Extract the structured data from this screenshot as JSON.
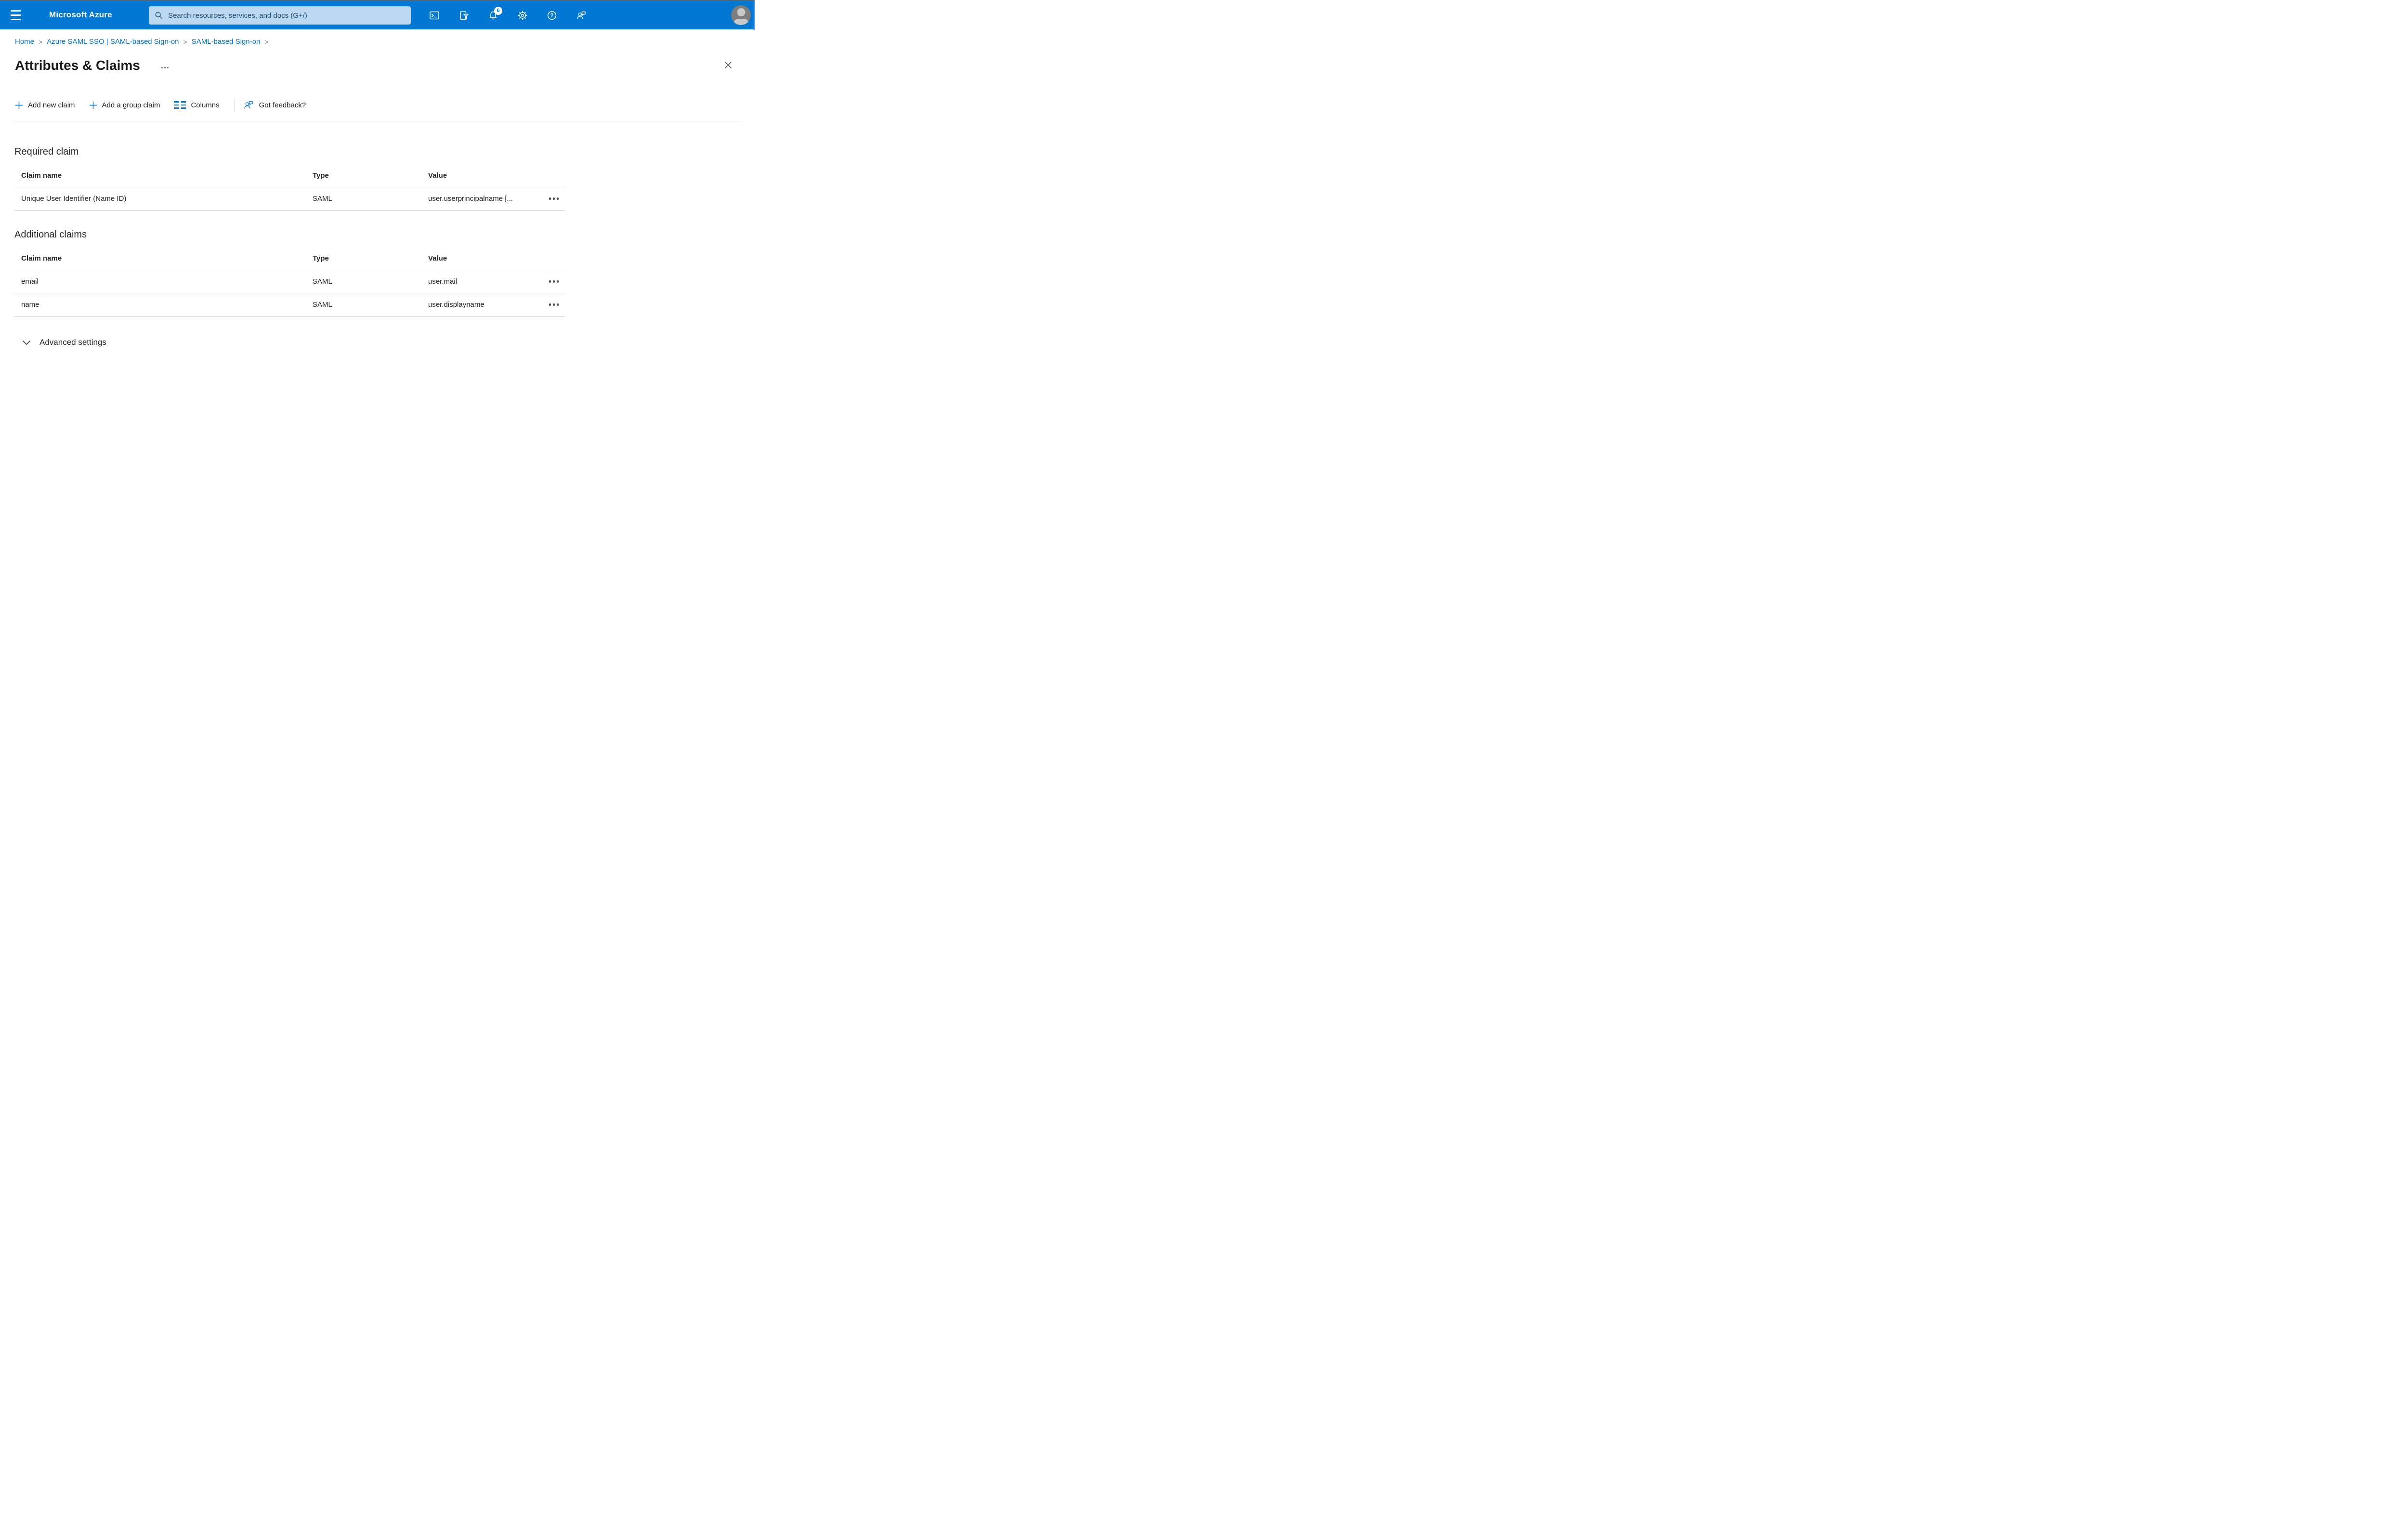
{
  "topbar": {
    "brand": "Microsoft Azure",
    "search_placeholder": "Search resources, services, and docs (G+/)",
    "notification_count": "6",
    "icons": [
      "cloud-shell-icon",
      "directory-filter-icon",
      "bell-icon",
      "gear-icon",
      "help-icon",
      "feedback-icon",
      "avatar"
    ]
  },
  "breadcrumb": {
    "separator": ">",
    "items": [
      {
        "label": "Home"
      },
      {
        "label": "Azure SAML SSO | SAML-based Sign-on"
      },
      {
        "label": "SAML-based Sign-on"
      }
    ]
  },
  "page": {
    "title": "Attributes & Claims"
  },
  "toolbar": {
    "items": [
      {
        "label": "Add new claim",
        "icon": "plus-icon"
      },
      {
        "label": "Add a group claim",
        "icon": "plus-icon"
      },
      {
        "label": "Columns",
        "icon": "columns-icon"
      },
      {
        "label": "Got feedback?",
        "icon": "feedback-person-icon"
      }
    ]
  },
  "sections": {
    "required": {
      "heading": "Required claim",
      "columns": [
        "Claim name",
        "Type",
        "Value"
      ],
      "rows": [
        {
          "name": "Unique User Identifier (Name ID)",
          "type": "SAML",
          "value": "user.userprincipalname [..."
        }
      ]
    },
    "additional": {
      "heading": "Additional claims",
      "columns": [
        "Claim name",
        "Type",
        "Value"
      ],
      "rows": [
        {
          "name": "email",
          "type": "SAML",
          "value": "user.mail"
        },
        {
          "name": "name",
          "type": "SAML",
          "value": "user.displayname"
        }
      ]
    }
  },
  "advanced": {
    "label": "Advanced settings"
  },
  "colors": {
    "topbar_bg": "#0078d4",
    "searchbox_bg": "#bbd8f0",
    "searchbox_text": "#1b4e79",
    "link_blue": "#0072c9",
    "accent_blue": "#0f7ad1",
    "badge_bg": "#ffffff",
    "badge_text": "#0078d4",
    "header_border": "#e6e6e6",
    "row_border": "#bdbdbd",
    "toolbar_divider": "#d8d8d8"
  }
}
